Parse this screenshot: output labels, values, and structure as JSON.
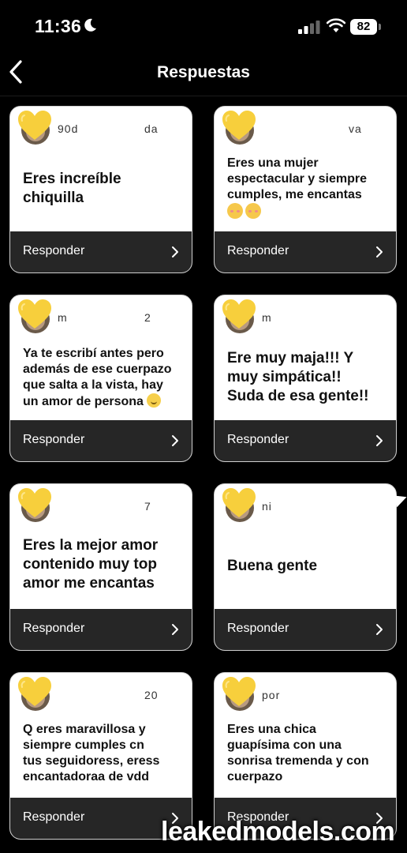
{
  "status": {
    "time": "11:36",
    "battery": "82"
  },
  "nav": {
    "title": "Respuestas"
  },
  "cards": [
    {
      "user": "90d",
      "user_tail": "da",
      "lines": [
        "Eres increíble",
        "chiquilla"
      ],
      "reply": "Responder"
    },
    {
      "user": "",
      "user_tail": "va",
      "lines": [
        "Eres una mujer",
        "espectacular y siempre",
        "cumples, me encantas"
      ],
      "reply": "Responder"
    },
    {
      "user": "m",
      "user_tail": "2",
      "lines": [
        "Ya te escribí antes pero",
        "además de ese cuerpazo",
        "que salta a la vista, hay",
        "un amor de persona"
      ],
      "reply": "Responder"
    },
    {
      "user": "m",
      "user_tail": "",
      "lines": [
        "Ere muy maja!!! Y",
        "muy simpática!!",
        "Suda de esa gente!!"
      ],
      "reply": "Responder"
    },
    {
      "user": "",
      "user_tail": "7",
      "lines": [
        "Eres la mejor amor",
        "contenido muy top",
        "amor me encantas"
      ],
      "reply": "Responder"
    },
    {
      "user": "ni",
      "user_tail": "",
      "lines": [
        "Buena gente"
      ],
      "reply": "Responder"
    },
    {
      "user": "",
      "user_tail": "20",
      "lines": [
        "Q eres maravillosa y",
        "siempre cumples cn",
        "tus seguidoress, eress",
        "encantadoraa de vdd"
      ],
      "reply": "Responder"
    },
    {
      "user": "por",
      "user_tail": "",
      "lines": [
        "Eres una chica",
        "guapísima con una",
        "sonrisa tremenda y con",
        "cuerpazo"
      ],
      "reply": "Responder"
    }
  ],
  "watermark": "leakedmodels.com"
}
